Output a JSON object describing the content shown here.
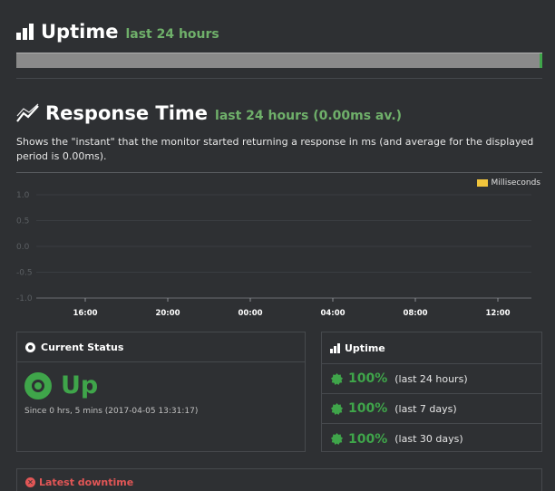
{
  "uptime_section": {
    "title": "Uptime",
    "subtitle": "last 24 hours",
    "bar_colors": {
      "track": "#8a8a8a",
      "up": "#3fa54a"
    }
  },
  "response_section": {
    "title": "Response Time",
    "subtitle": "last 24 hours (0.00ms av.)",
    "description": "Shows the \"instant\" that the monitor started returning a response in ms (and average for the displayed period is 0.00ms)."
  },
  "chart_data": {
    "type": "line",
    "series": [
      {
        "name": "Milliseconds",
        "values": []
      }
    ],
    "x_tick_labels": [
      "16:00",
      "20:00",
      "00:00",
      "04:00",
      "08:00",
      "12:00"
    ],
    "y_tick_labels": [
      "1.0",
      "0.5",
      "0.0",
      "-0.5",
      "-1.0"
    ],
    "ylim": [
      -1.0,
      1.0
    ],
    "legend_placement": "top-right",
    "legend_color": "#f0c43c",
    "grid": true
  },
  "current_status": {
    "title": "Current Status",
    "status": "Up",
    "since": "Since 0 hrs, 5 mins (2017-04-05 13:31:17)",
    "color": "#3fa54a"
  },
  "uptime_panel": {
    "title": "Uptime",
    "rows": [
      {
        "pct": "100%",
        "period": "(last 24 hours)"
      },
      {
        "pct": "100%",
        "period": "(last 7 days)"
      },
      {
        "pct": "100%",
        "period": "(last 30 days)"
      }
    ]
  },
  "latest_downtime": {
    "title": "Latest downtime",
    "color": "#e25656"
  }
}
